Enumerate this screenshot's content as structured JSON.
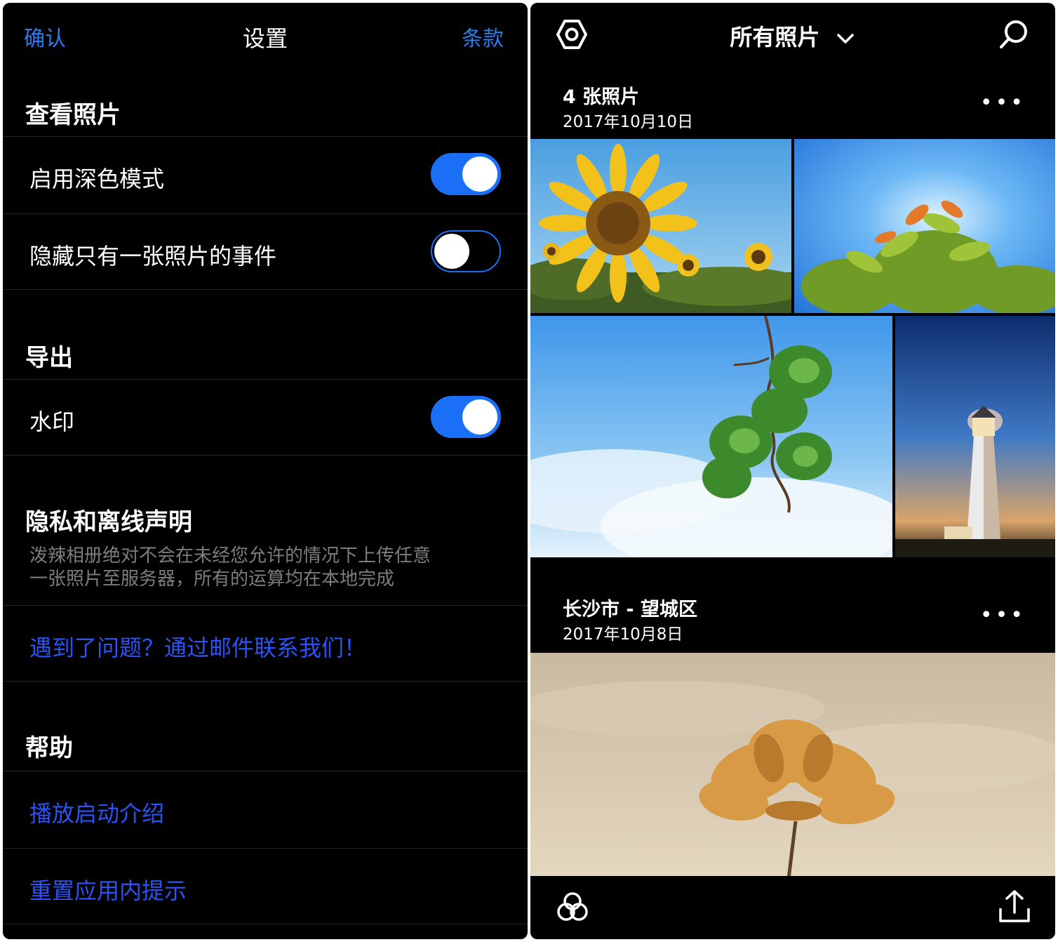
{
  "settings": {
    "confirm_label": "确认",
    "title": "设置",
    "terms_label": "条款",
    "view_photos": {
      "section_title": "查看照片",
      "dark_mode_label": "启用深色模式",
      "dark_mode_on": true,
      "hide_single_label": "隐藏只有一张照片的事件",
      "hide_single_on": false
    },
    "export": {
      "section_title": "导出",
      "watermark_label": "水印",
      "watermark_on": true
    },
    "privacy": {
      "section_title": "隐私和离线声明",
      "note_line1": "泼辣相册绝对不会在未经您允许的情况下上传任意",
      "note_line2": "一张照片至服务器，所有的运算均在本地完成",
      "contact_link": "遇到了问题？通过邮件联系我们！"
    },
    "help": {
      "section_title": "帮助",
      "play_intro_link": "播放启动介绍",
      "reset_tips_link": "重置应用内提示"
    }
  },
  "photos": {
    "header_title": "所有照片",
    "icons": {
      "settings": "hexagon-settings-icon",
      "dropdown": "chevron-down-icon",
      "search": "search-icon",
      "albums": "circles-icon",
      "share": "share-icon"
    },
    "events": [
      {
        "title": "4 张照片",
        "date": "2017年10月10日",
        "more": "•••"
      },
      {
        "title": "长沙市 - 望城区",
        "date": "2017年10月8日",
        "more": "•••"
      }
    ]
  },
  "colors": {
    "accent_blue": "#2f7bf0",
    "link_blue": "#2a52f5",
    "toggle_blue": "#1b6ff7",
    "background": "#000000"
  }
}
